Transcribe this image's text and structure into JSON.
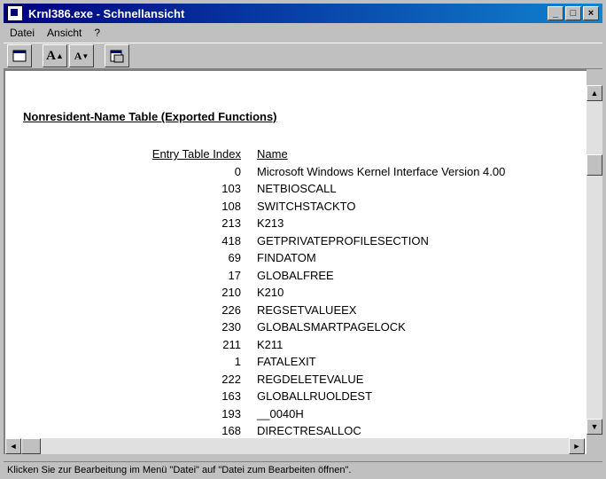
{
  "window": {
    "title": "Krnl386.exe - Schnellansicht",
    "buttons": {
      "minimize": "_",
      "maximize": "□",
      "close": "×"
    }
  },
  "menu": [
    {
      "label": "Datei"
    },
    {
      "label": "Ansicht"
    },
    {
      "label": "?"
    }
  ],
  "toolbar": {
    "fullscreen_icon": "window-icon",
    "font_larger": "A",
    "font_smaller": "A",
    "open_icon": "open-file-icon"
  },
  "content": {
    "heading": "Nonresident-Name Table (Exported Functions)",
    "columns": {
      "index": "Entry Table Index",
      "name": "Name"
    },
    "rows": [
      {
        "index": "0",
        "name": "Microsoft Windows Kernel Interface Version 4.00"
      },
      {
        "index": "103",
        "name": "NETBIOSCALL"
      },
      {
        "index": "108",
        "name": "SWITCHSTACKTO"
      },
      {
        "index": "213",
        "name": "K213"
      },
      {
        "index": "418",
        "name": "GETPRIVATEPROFILESECTION"
      },
      {
        "index": "69",
        "name": "FINDATOM"
      },
      {
        "index": "17",
        "name": "GLOBALFREE"
      },
      {
        "index": "210",
        "name": "K210"
      },
      {
        "index": "226",
        "name": "REGSETVALUEEX"
      },
      {
        "index": "230",
        "name": "GLOBALSMARTPAGELOCK"
      },
      {
        "index": "211",
        "name": "K211"
      },
      {
        "index": "1",
        "name": "FATALEXIT"
      },
      {
        "index": "222",
        "name": "REGDELETEVALUE"
      },
      {
        "index": "163",
        "name": "GLOBALLRUOLDEST"
      },
      {
        "index": "193",
        "name": "__0040H"
      },
      {
        "index": "168",
        "name": "DIRECTRESALLOC"
      }
    ]
  },
  "statusbar": {
    "text": "Klicken Sie zur Bearbeitung im Menü \"Datei\" auf \"Datei zum Bearbeiten öffnen\"."
  }
}
